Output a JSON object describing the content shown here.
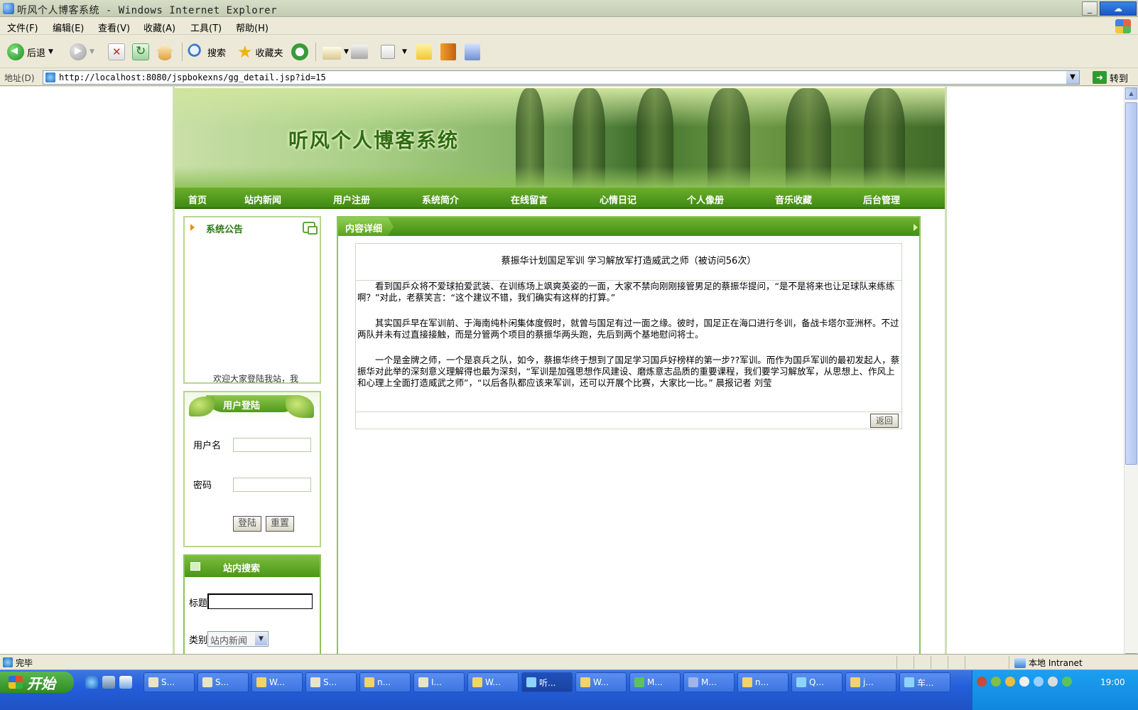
{
  "window": {
    "title": "听风个人博客系统 - Windows Internet Explorer"
  },
  "menu": [
    "文件(F)",
    "编辑(E)",
    "查看(V)",
    "收藏(A)",
    "工具(T)",
    "帮助(H)"
  ],
  "toolbar": {
    "back_label": "后退",
    "search_label": "搜索",
    "favorites_label": "收藏夹"
  },
  "address": {
    "label": "地址(D)",
    "url": "http://localhost:8080/jspbokexns/gg_detail.jsp?id=15",
    "go_label": "转到"
  },
  "site": {
    "title": "听风个人博客系统",
    "nav": [
      "首页",
      "站内新闻",
      "用户注册",
      "系统简介",
      "在线留言",
      "心情日记",
      "个人像册",
      "音乐收藏",
      "后台管理"
    ]
  },
  "notice": {
    "title": "系统公告",
    "marquee": "欢迎大家登陆我站，我"
  },
  "login": {
    "title": "用户登陆",
    "username_label": "用户名",
    "password_label": "密码",
    "login_button": "登陆",
    "reset_button": "重置"
  },
  "search": {
    "title": "站内搜索",
    "title_label": "标题",
    "category_label": "类别",
    "category_selected": "站内新闻"
  },
  "content": {
    "header": "内容详细",
    "article_title": "蔡振华计划国足军训 学习解放军打造威武之师（被访问56次）",
    "paragraphs": [
      "看到国乒众将不爱球拍爱武装、在训练场上飒爽英姿的一面，大家不禁向刚刚接管男足的蔡振华提问，“是不是将来也让足球队来练练啊？”对此，老蔡笑言：“这个建议不错，我们确实有这样的打算。”",
      "其实国乒早在军训前、于海南纯朴闲集体度假时，就曾与国足有过一面之缘。彼时，国足正在海口进行冬训，备战卡塔尔亚洲杯。不过两队并未有过直接接触，而是分管两个项目的蔡振华两头跑，先后到两个基地慰问将士。",
      "一个是金牌之师，一个是哀兵之队，如今，蔡振华终于想到了国足学习国乒好榜样的第一步??军训。而作为国乒军训的最初发起人，蔡振华对此举的深刻意义理解得也最为深刻，“军训是加强思想作风建设、磨炼意志品质的重要课程，我们要学习解放军，从思想上、作风上和心理上全面打造威武之师”，“以后各队都应该来军训，还可以开展个比赛，大家比一比。” 晨报记者 刘莹"
    ],
    "back_button": "返回"
  },
  "status": {
    "text": "完毕",
    "zone": "本地 Intranet"
  },
  "taskbar": {
    "start_label": "开始",
    "tasks": [
      "S...",
      "S...",
      "W...",
      "S...",
      "n...",
      "I...",
      "W...",
      "听...",
      "W...",
      "M...",
      "M...",
      "n...",
      "Q...",
      "j...",
      "车..."
    ],
    "clock": "19:00"
  }
}
